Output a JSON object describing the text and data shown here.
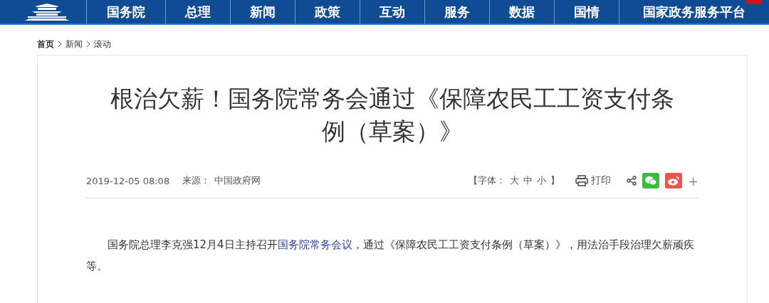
{
  "nav": {
    "items": [
      {
        "label": "国务院"
      },
      {
        "label": "总理"
      },
      {
        "label": "新闻"
      },
      {
        "label": "政策"
      },
      {
        "label": "互动"
      },
      {
        "label": "服务"
      },
      {
        "label": "数据"
      },
      {
        "label": "国情"
      },
      {
        "label": "国家政务服务平台",
        "badge": true
      }
    ]
  },
  "breadcrumb": [
    "首页",
    "新闻",
    "滚动"
  ],
  "article": {
    "title": "根治欠薪！国务院常务会通过《保障农民工工资支付条例（草案）》",
    "date": "2019-12-05 08:08",
    "source_label": "来源：",
    "source": "中国政府网",
    "font_label": "【字体：",
    "font_sizes": [
      "大",
      "中",
      "小"
    ],
    "font_end": "】",
    "print": "打印",
    "more": "+",
    "paragraph": {
      "before": "国务院总理李克强12月4日主持召开",
      "link": "国务院常务会议",
      "after": "，通过《保障农民工工资支付条例（草案）》，用法治手段治理欠薪顽疾等。"
    }
  }
}
